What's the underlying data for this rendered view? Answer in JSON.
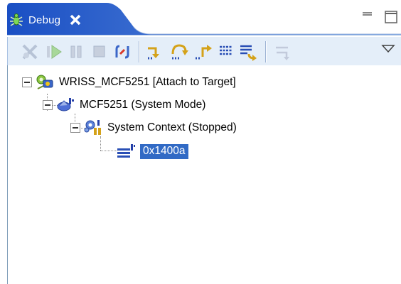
{
  "view": {
    "tab_label": "Debug",
    "tab_icon": "debug-bug-icon",
    "window_buttons": [
      "minimize-icon",
      "maximize-icon"
    ]
  },
  "toolbar": {
    "buttons": [
      {
        "name": "remove-terminated-icon",
        "enabled": false
      },
      {
        "name": "resume-icon",
        "enabled": false
      },
      {
        "name": "suspend-icon",
        "enabled": false
      },
      {
        "name": "terminate-icon",
        "enabled": false
      },
      {
        "name": "disconnect-icon",
        "enabled": true
      },
      {
        "name": "step-into-icon",
        "enabled": true
      },
      {
        "name": "step-over-icon",
        "enabled": true
      },
      {
        "name": "step-return-icon",
        "enabled": true
      },
      {
        "name": "instruction-stepping-icon",
        "enabled": true
      },
      {
        "name": "drop-to-frame-icon",
        "enabled": true
      },
      {
        "name": "use-step-filters-icon",
        "enabled": false
      },
      {
        "name": "view-menu-icon",
        "enabled": true
      }
    ]
  },
  "tree": {
    "nodes": [
      {
        "label": "WRISS_MCF5251 [Attach to Target]",
        "icon": "launch-config-icon",
        "expanded": true
      },
      {
        "label": "MCF5251 (System Mode)",
        "icon": "debug-target-icon",
        "expanded": true
      },
      {
        "label": "System Context (Stopped)",
        "icon": "thread-context-icon",
        "expanded": true
      },
      {
        "label": "0x1400a",
        "icon": "stack-frame-icon",
        "selected": true
      }
    ]
  },
  "colors": {
    "tab_gradient_start": "#1e56c8",
    "tab_gradient_end": "#7aa6e6",
    "selection": "#316ac5"
  }
}
